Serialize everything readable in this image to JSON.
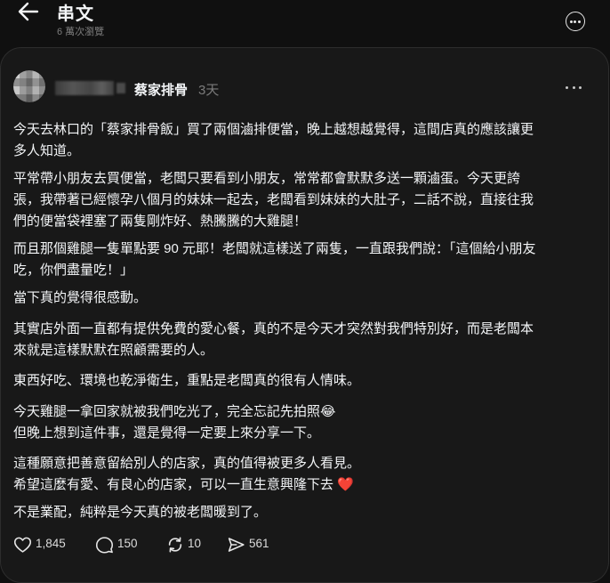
{
  "header": {
    "title": "串文",
    "views": "6 萬次瀏覽"
  },
  "post": {
    "author": "蔡家排骨",
    "time": "3天",
    "paragraphs": [
      "今天去林口的「蔡家排骨飯」買了兩個滷排便當，晚上越想越覺得，這間店真的應該讓更\n多人知道。",
      "平常帶小朋友去買便當，老闆只要看到小朋友，常常都會默默多送一顆滷蛋。今天更誇\n張，我帶著已經懷孕八個月的妹妹一起去，老闆看到妹妹的大肚子，二話不說，直接往我\n們的便當袋裡塞了兩隻剛炸好、熱騰騰的大雞腿！",
      "而且那個雞腿一隻單點要 90 元耶！老闆就這樣送了兩隻，一直跟我們說：「這個給小朋友\n吃，你們盡量吃！」",
      "當下真的覺得很感動。",
      "其實店外面一直都有提供免費的愛心餐，真的不是今天才突然對我們特別好，而是老闆本\n來就是這樣默默在照顧需要的人。",
      "東西好吃、環境也乾淨衛生，重點是老闆真的很有人情味。",
      "今天雞腿一拿回家就被我們吃光了，完全忘記先拍照😂\n但晚上想到這件事，還是覺得一定要上來分享一下。",
      "這種願意把善意留給別人的店家，真的值得被更多人看見。\n希望這麼有愛、有良心的店家，可以一直生意興隆下去 ❤️",
      "不是業配，純粹是今天真的被老闆暖到了。"
    ]
  },
  "actions": {
    "likes": "1,845",
    "comments": "150",
    "reposts": "10",
    "shares": "561"
  },
  "icons": {
    "back": "arrow-left-icon",
    "more": "more-circle-icon",
    "like": "heart-icon",
    "comment": "comment-bubble-icon",
    "repost": "repost-icon",
    "share": "send-icon"
  },
  "colors": {
    "background": "#101010",
    "card": "#181818",
    "text": "#f3f5f7",
    "muted": "#7b7b7b",
    "heart": "#e0245e"
  }
}
